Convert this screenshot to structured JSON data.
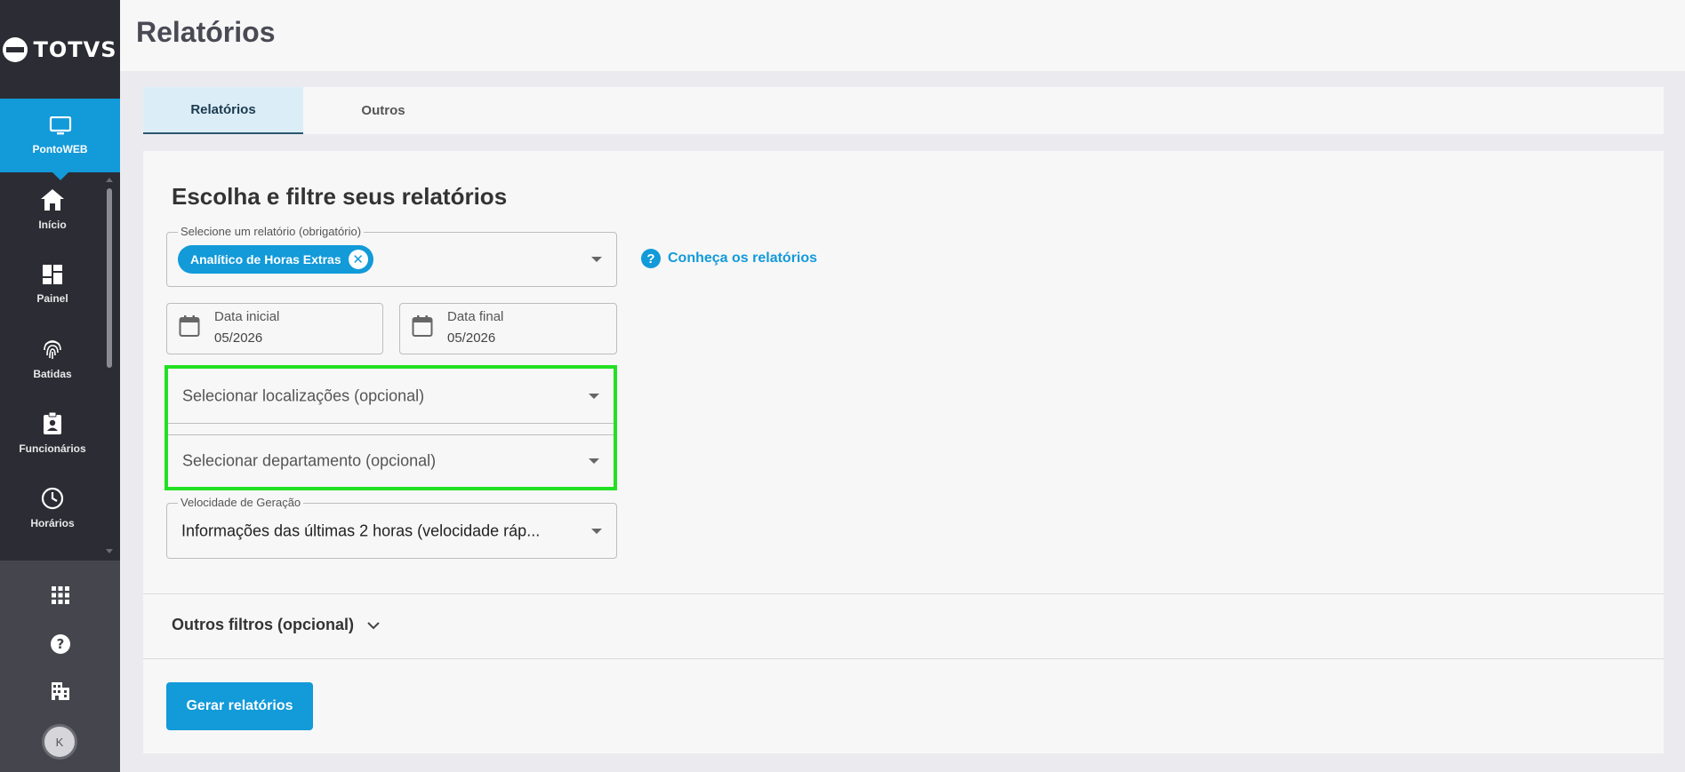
{
  "brand": {
    "name": "TOTVS"
  },
  "header": {
    "title": "Relatórios"
  },
  "sidebar": {
    "active": {
      "label": "PontoWEB",
      "icon": "monitor-icon"
    },
    "items": [
      {
        "label": "Início",
        "icon": "home-icon"
      },
      {
        "label": "Painel",
        "icon": "dashboard-icon"
      },
      {
        "label": "Batidas",
        "icon": "fingerprint-icon"
      },
      {
        "label": "Funcionários",
        "icon": "badge-icon"
      },
      {
        "label": "Horários",
        "icon": "clock-icon"
      }
    ],
    "bottom": [
      {
        "icon": "apps-grid-icon"
      },
      {
        "icon": "help-icon"
      },
      {
        "icon": "building-icon"
      }
    ],
    "avatar_initial": "K"
  },
  "tabs": [
    {
      "label": "Relatórios",
      "active": true
    },
    {
      "label": "Outros",
      "active": false
    }
  ],
  "main": {
    "section_title": "Escolha e filtre seus relatórios",
    "report_select": {
      "legend": "Selecione um relatório (obrigatório)",
      "chip": "Analítico de Horas Extras"
    },
    "help_link": "Conheça os relatórios",
    "start_date": {
      "label": "Data inicial",
      "value": "05/2026"
    },
    "end_date": {
      "label": "Data final",
      "value": "05/2026"
    },
    "locations_select": "Selecionar localizações (opcional)",
    "department_select": "Selecionar departamento (opcional)",
    "speed_select": {
      "legend": "Velocidade de Geração",
      "value": "Informações das últimas 2 horas (velocidade ráp..."
    },
    "other_filters": "Outros filtros (opcional)",
    "generate_button": "Gerar relatórios"
  },
  "colors": {
    "accent": "#129ad9",
    "sidebar": "#2c2c34",
    "highlight": "#22e022"
  }
}
